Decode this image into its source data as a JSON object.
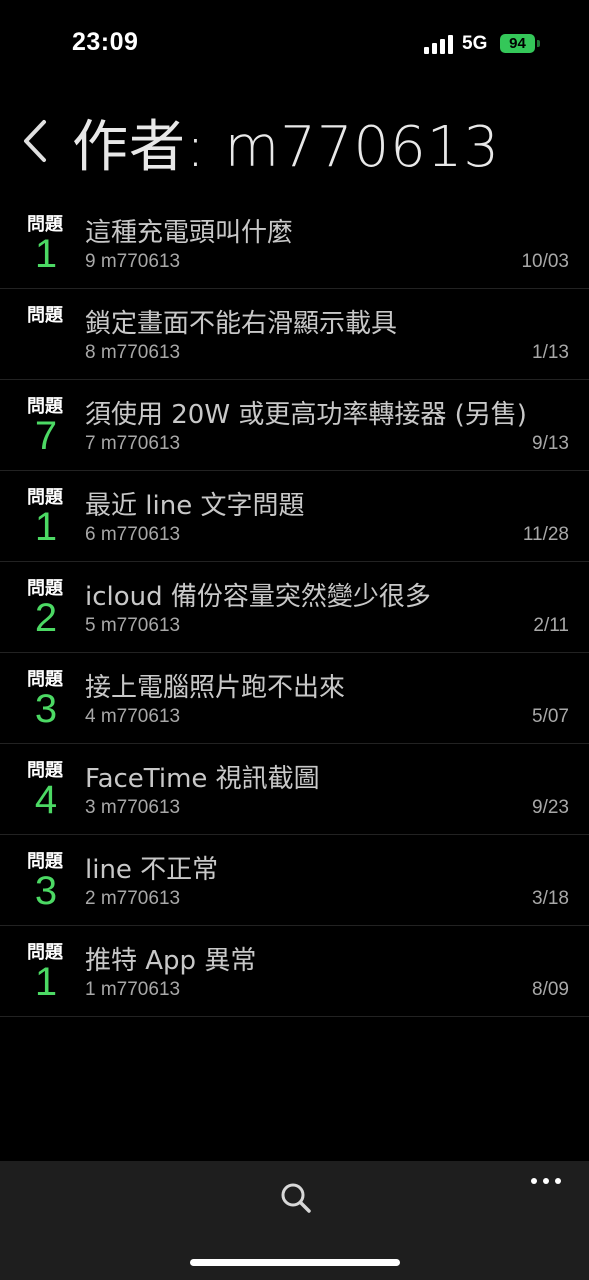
{
  "status_bar": {
    "time": "23:09",
    "network": "5G",
    "battery": "94"
  },
  "nav": {
    "title": "作者: m770613",
    "back_icon": "chevron-left-icon"
  },
  "list": {
    "question_label": "問題",
    "items": [
      {
        "count": "1",
        "title": "這種充電頭叫什麼",
        "meta": "9 m770613",
        "date": "10/03"
      },
      {
        "count": "",
        "title": "鎖定畫面不能右滑顯示載具",
        "meta": "8 m770613",
        "date": "1/13"
      },
      {
        "count": "7",
        "title": "須使用 20W 或更高功率轉接器 (另售)",
        "meta": "7 m770613",
        "date": "9/13"
      },
      {
        "count": "1",
        "title": "最近 line 文字問題",
        "meta": "6 m770613",
        "date": "11/28"
      },
      {
        "count": "2",
        "title": "icloud 備份容量突然變少很多",
        "meta": "5 m770613",
        "date": "2/11"
      },
      {
        "count": "3",
        "title": "接上電腦照片跑不出來",
        "meta": "4 m770613",
        "date": "5/07"
      },
      {
        "count": "4",
        "title": "FaceTime 視訊截圖",
        "meta": "3 m770613",
        "date": "9/23"
      },
      {
        "count": "3",
        "title": "line 不正常",
        "meta": "2 m770613",
        "date": "3/18"
      },
      {
        "count": "1",
        "title": "推特 App 異常",
        "meta": "1 m770613",
        "date": "8/09"
      }
    ]
  },
  "toolbar": {
    "search_icon": "search-icon",
    "more_icon": "more-icon"
  },
  "colors": {
    "accent": "#4cd964",
    "background": "#000000",
    "toolbar": "#1e1e1e",
    "battery": "#34c759"
  }
}
